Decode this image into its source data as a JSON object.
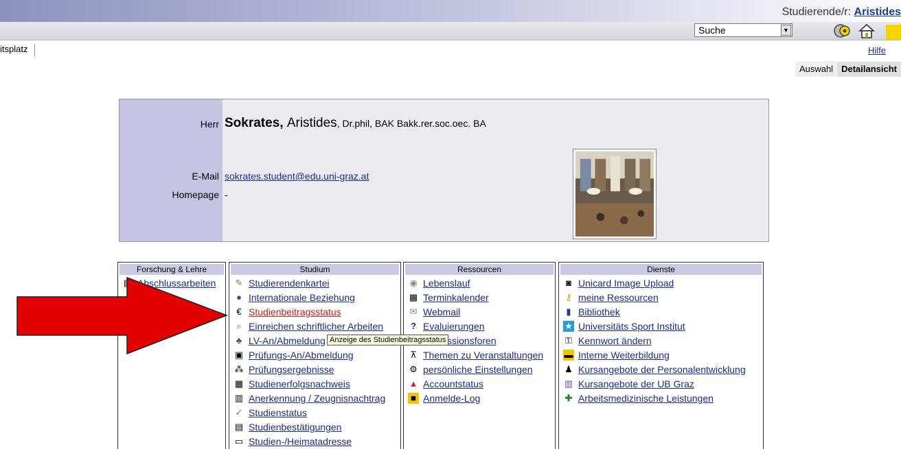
{
  "header": {
    "user_prefix": "Studierende/r:",
    "user_name": "Aristides",
    "search_value": "Suche",
    "tab_label": "itsplatz",
    "help_link": "Hilfe",
    "view_tabs": [
      "Auswahl",
      "Detailansicht"
    ]
  },
  "person": {
    "salutation_label": "Herr",
    "last_name": "Sokrates,",
    "first_name": "Aristides",
    "titles": ", Dr.phil, BAK Bakk.rer.soc.oec. BA",
    "email_label": "E-Mail",
    "email": "sokrates.student@edu.uni-graz.at",
    "homepage_label": "Homepage",
    "homepage": "-"
  },
  "menus": {
    "forschung": {
      "title": "Forschung & Lehre",
      "items": [
        "Abschlussarbeiten"
      ]
    },
    "studium": {
      "title": "Studium",
      "items": [
        "Studierendenkartei",
        "Internationale Beziehung",
        "Studienbeitragsstatus",
        "Einreichen schriftlicher Arbeiten",
        "LV-An/Abmeldung",
        "Prüfungs-An/Abmeldung",
        "Prüfungsergebnisse",
        "Studienerfolgsnachweis",
        "Anerkennung / Zeugnisnachtrag",
        "Studienstatus",
        "Studienbestätigungen",
        "Studien-/Heimatadresse"
      ]
    },
    "ressourcen": {
      "title": "Ressourcen",
      "items": [
        "Lebenslauf",
        "Terminkalender",
        "Webmail",
        "Evaluierungen",
        "Diskussionsforen",
        "Themen zu Veranstaltungen",
        "persönliche Einstellungen",
        "Accountstatus",
        "Anmelde-Log"
      ]
    },
    "dienste": {
      "title": "Dienste",
      "items": [
        "Unicard Image Upload",
        "meine Ressourcen",
        "Bibliothek",
        "Universitäts Sport Institut",
        "Kennwort ändern",
        "Interne Weiterbildung",
        "Kursangebote der Personalentwicklung",
        "Kursangebote der UB Graz",
        "Arbeitsmedizinische Leistungen"
      ]
    }
  },
  "tooltip": "Anzeige des Studienbeitragsstatus",
  "colors": {
    "accent": "#c3c5e2",
    "link": "#1a2a8c",
    "active_link": "#c0201a",
    "arrow": "#e00000"
  }
}
